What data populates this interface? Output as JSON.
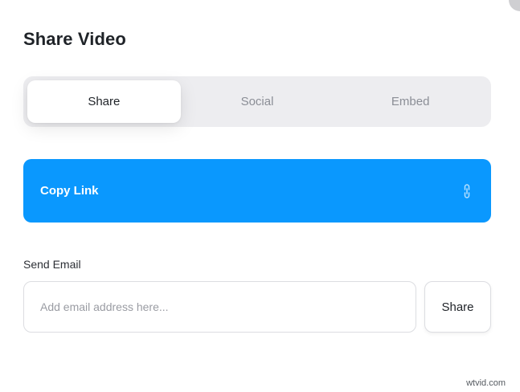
{
  "dialog": {
    "title": "Share Video"
  },
  "tabs": [
    {
      "label": "Share",
      "active": true
    },
    {
      "label": "Social",
      "active": false
    },
    {
      "label": "Embed",
      "active": false
    }
  ],
  "copy_link": {
    "label": "Copy Link",
    "icon": "link-icon",
    "color": "#0a98fe"
  },
  "send_email": {
    "label": "Send Email",
    "input_value": "",
    "placeholder": "Add email address here...",
    "button_label": "Share"
  },
  "watermark": "wtvid.com"
}
